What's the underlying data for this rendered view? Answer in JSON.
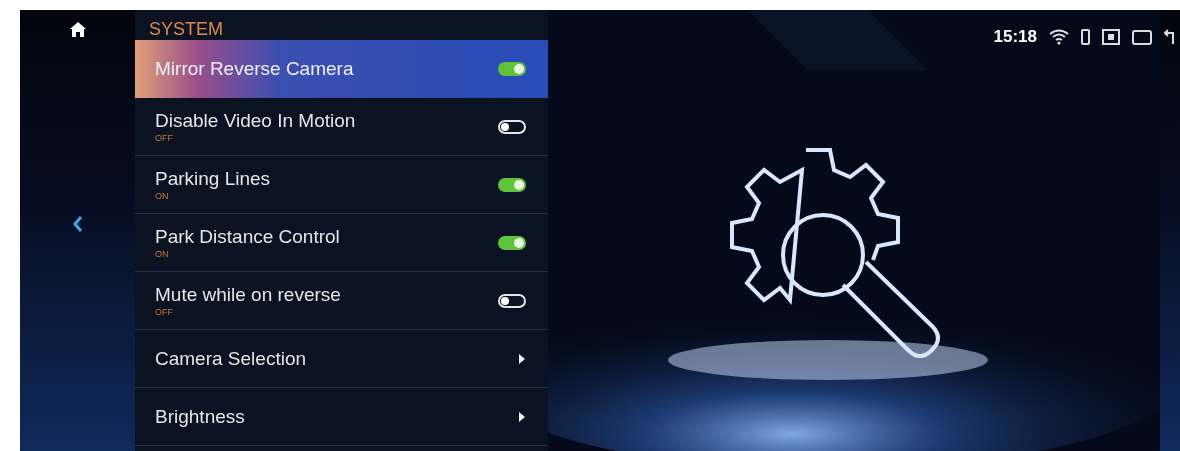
{
  "status_bar": {
    "time": "15:18"
  },
  "panel": {
    "title": "SYSTEM"
  },
  "items": [
    {
      "kind": "toggle",
      "label": "Mirror Reverse Camera",
      "on": true,
      "selected": true
    },
    {
      "kind": "toggle",
      "label": "Disable Video In Motion",
      "status": "OFF",
      "on": false,
      "selected": false
    },
    {
      "kind": "toggle",
      "label": "Parking Lines",
      "status": "ON",
      "on": true,
      "selected": false
    },
    {
      "kind": "toggle",
      "label": "Park Distance Control",
      "status": "ON",
      "on": true,
      "selected": false
    },
    {
      "kind": "toggle",
      "label": "Mute while on reverse",
      "status": "OFF",
      "on": false,
      "selected": false
    },
    {
      "kind": "link",
      "label": "Camera Selection",
      "selected": false
    },
    {
      "kind": "link",
      "label": "Brightness",
      "selected": false
    }
  ]
}
